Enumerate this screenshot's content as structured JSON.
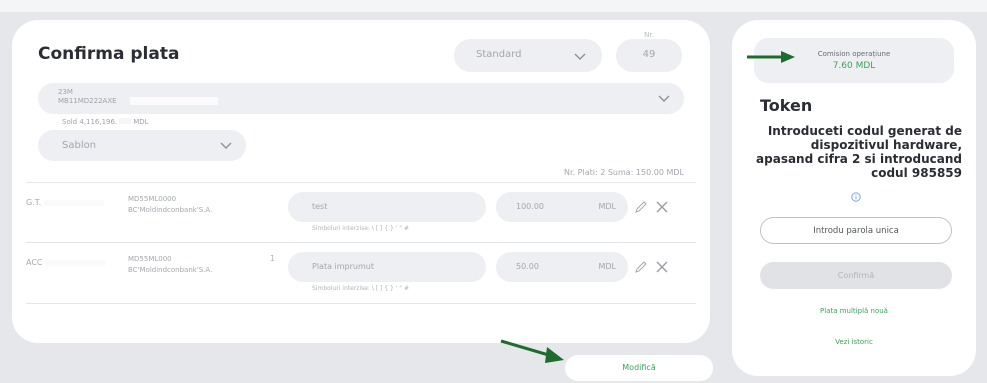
{
  "payment": {
    "title": "Confirma plata",
    "type_select": "Standard",
    "nr_label": "Nr.",
    "nr_value": "49",
    "account_line1": "23M",
    "account_line2": "MB11MD222AXE",
    "balance": "Sold 4,116,196.",
    "balance_currency": "MDL",
    "template_select": "Sablon",
    "summary": "Nr. Plati: 2   Suma: 150.00 MDL",
    "rows": [
      {
        "name": "G.T.",
        "iban": "MD55ML0000",
        "bank": "BC'Moldindconbank'S.A.",
        "mark": "",
        "details": "test",
        "hint": "Simboluri interzise: \\ [ ] { } ' \" #",
        "amount": "100.00",
        "currency": "MDL"
      },
      {
        "name": "ACC",
        "iban": "MD55ML000",
        "bank": "BC'Moldindconbank'S.A.",
        "mark": "1",
        "details": "Plata imprumut",
        "hint": "Simboluri interzise: \\ [ ] { } ' \" #",
        "amount": "50.00",
        "currency": "MDL"
      }
    ],
    "modify_button": "Modifică"
  },
  "token_panel": {
    "fee_label": "Comision operațiune",
    "fee_value": "7.60 MDL",
    "title": "Token",
    "instructions": "Introduceti codul generat de dispozitivul hardware, apasand cifra 2 si introducand codul 985859",
    "password_placeholder": "Introdu parola unica",
    "confirm_button": "Confirmă",
    "link_new_multiple": "Plata multiplă nouă",
    "link_history": "Vezi istoric"
  },
  "colors": {
    "accent_green": "#3ea35a",
    "annotation_arrow": "#1d6b2d",
    "background": "#e6e7ea",
    "card": "#ffffff"
  },
  "icons": {
    "dropdown": "chevron-down-icon",
    "edit": "pencil-icon",
    "delete": "close-icon",
    "info": "info-icon",
    "annotation": "arrow-icon"
  }
}
